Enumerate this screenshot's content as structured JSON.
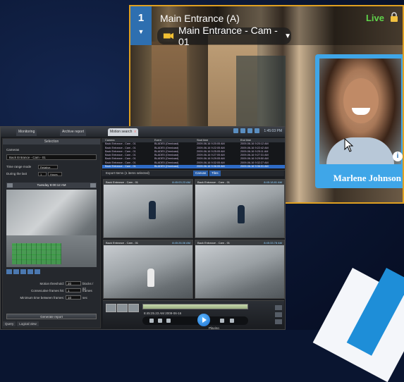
{
  "camera_view": {
    "tile_number": "1",
    "title": "Main Entrance (A)",
    "live_label": "Live",
    "selected_camera": "Main Entrance - Cam - 01",
    "person_name": "Marlene Johnson",
    "info_icon": "info-icon",
    "colors": {
      "border": "#e0a020",
      "live": "#5fd34a",
      "card": "#3fa6e8"
    }
  },
  "app": {
    "tabs": [
      {
        "label": "Monitoring"
      },
      {
        "label": "Archive report"
      },
      {
        "label": "Motion search"
      }
    ],
    "tab_close": "x",
    "clock": "1:45:03 PM",
    "selector": {
      "header": "Selection",
      "camera_section": "Cameras",
      "camera_value": "Back Entrance - Cam - 01",
      "time_range_label": "Time range mode",
      "time_range_value": "Relative",
      "during_label": "During the last",
      "during_value": "1",
      "during_unit": "Hours",
      "date": "Tuesday 8:00:12 AM",
      "motion_threshold_label": "Motion threshold:",
      "motion_threshold_value": "20",
      "motion_threshold_unit": "blocks / 62",
      "consecutive_label": "Consecutive frames hit:",
      "consecutive_value": "1",
      "consecutive_unit": "frames",
      "min_time_label": "Minimum time between frames:",
      "min_time_value": "10",
      "min_time_unit": "sec",
      "search_button": "Generate report",
      "bottom_tabs": [
        "Query",
        "Logical view"
      ]
    },
    "results": {
      "headers": [
        "Camera",
        "Event",
        "Start time",
        "End time"
      ],
      "rows": [
        {
          "camera": "Back Entrance - Cam - 01",
          "event": "BLADE5 (Omnicast)",
          "start": "2009-06-16 9:20:05 AM",
          "end": "2009-06-16 9:20:12 AM"
        },
        {
          "camera": "Back Entrance - Cam - 01",
          "event": "BLADE5 (Omnicast)",
          "start": "2009-06-16 9:22:05 AM",
          "end": "2009-06-16 9:22:42 AM"
        },
        {
          "camera": "Back Entrance - Cam - 01",
          "event": "BLADE5 (Omnicast)",
          "start": "2009-06-16 9:25:05 AM",
          "end": "2009-06-16 9:25:11 AM"
        },
        {
          "camera": "Back Entrance - Cam - 01",
          "event": "BLADE5 (Omnicast)",
          "start": "2009-06-16 9:27:05 AM",
          "end": "2009-06-16 9:27:31 AM"
        },
        {
          "camera": "Back Entrance - Cam - 01",
          "event": "BLADE5 (Omnicast)",
          "start": "2009-06-16 9:29:05 AM",
          "end": "2009-06-16 9:29:50 AM"
        },
        {
          "camera": "Back Entrance - Cam - 01",
          "event": "BLADE5 (Omnicast)",
          "start": "2009-06-16 9:32:05 AM",
          "end": "2009-06-16 9:32:27 AM"
        },
        {
          "camera": "Back Entrance - Cam - 01",
          "event": "BLADE5 (Omnicast)",
          "start": "2009-06-16 9:36:05 AM",
          "end": "2009-06-16 9:36:31 AM"
        }
      ],
      "toolbar_text": "Export  Items  (1 items selected)",
      "view_tabs": [
        "Canvas",
        "Tiles"
      ]
    },
    "tiles": [
      {
        "title": "Back Entrance - Cam - 01",
        "time": "8:45:03.23 AM"
      },
      {
        "title": "Back Entrance - Cam - 01",
        "time": "8:45:18.81 AM"
      },
      {
        "title": "Back Entrance - Cam - 01",
        "time": "8:45:26.06 AM"
      },
      {
        "title": "Back Entrance - Cam - 01",
        "time": "8:45:33.78 AM"
      }
    ],
    "player": {
      "time_text": "8:45:25.23 AM  2009-06-16",
      "status": "Playing",
      "colors": {
        "play": "#1c6fd0"
      }
    }
  }
}
